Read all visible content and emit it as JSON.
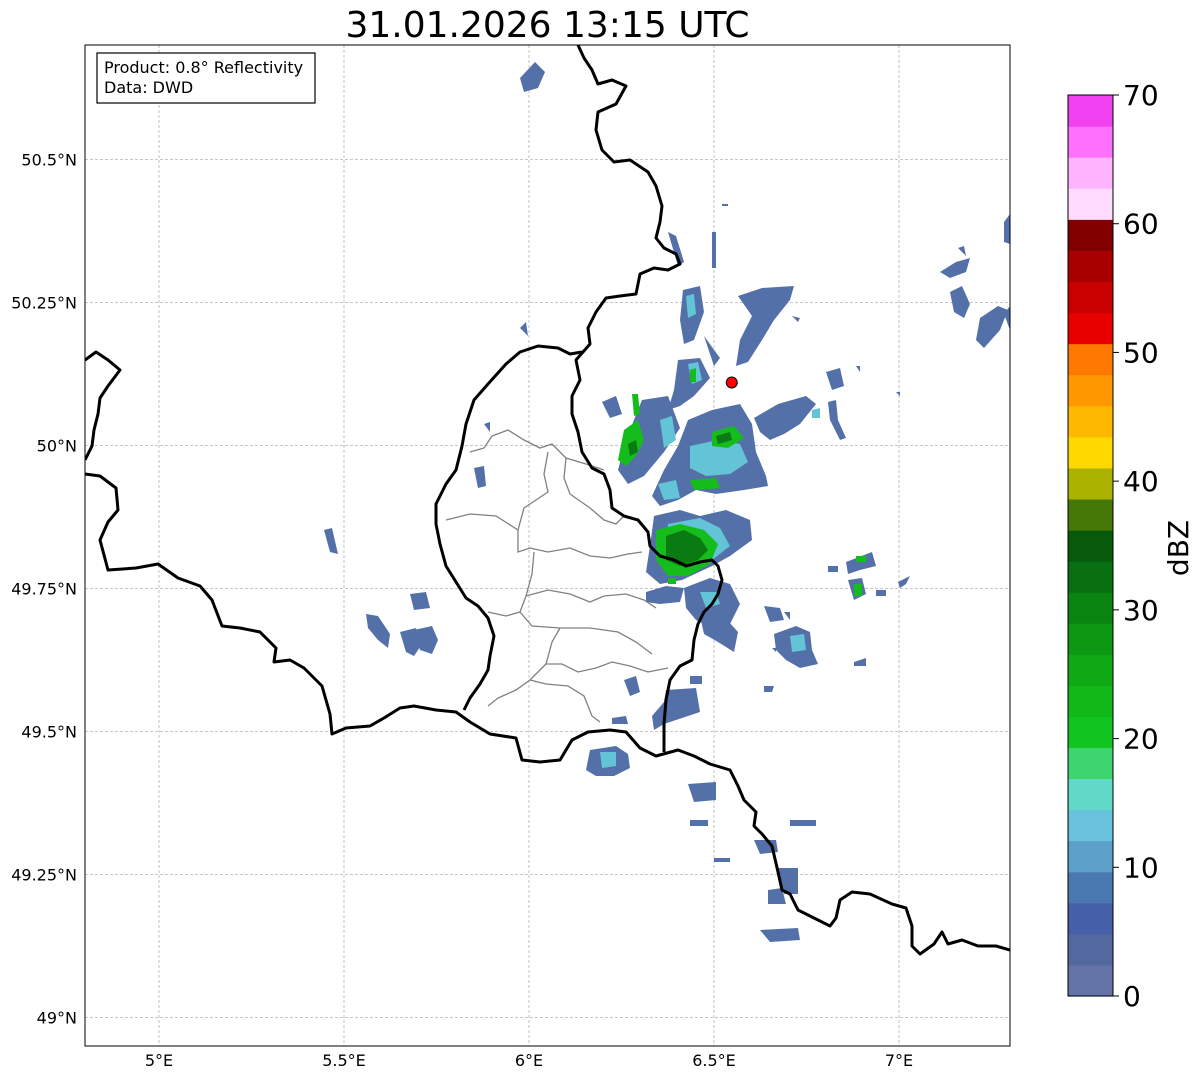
{
  "title": "31.01.2026 13:15 UTC",
  "info_box": {
    "product": "Product: 0.8° Reflectivity",
    "data": "Data: DWD"
  },
  "map": {
    "lon_range": [
      4.8,
      7.3
    ],
    "lat_range": [
      48.95,
      50.7
    ],
    "gridlines": true,
    "lon_ticks": [
      "5°E",
      "5.5°E",
      "6°E",
      "6.5°E",
      "7°E"
    ],
    "lat_ticks": [
      "49°N",
      "49.25°N",
      "49.5°N",
      "49.75°N",
      "50°N",
      "50.25°N",
      "50.5°N"
    ],
    "radar_site": {
      "lon": 6.548,
      "lat": 50.11,
      "color": "#ff0000"
    }
  },
  "colorbar": {
    "label": "dBZ",
    "min": 0,
    "max": 70,
    "tick_labels": [
      "0",
      "10",
      "20",
      "30",
      "40",
      "50",
      "60",
      "70"
    ],
    "colors": [
      "#6474a8",
      "#5468a0",
      "#4560a8",
      "#4a78b0",
      "#5aa0c8",
      "#68c2dc",
      "#62d8c8",
      "#3ed470",
      "#12c420",
      "#10b818",
      "#10a814",
      "#0c9812",
      "#0a8410",
      "#087010",
      "#065a0a",
      "#467808",
      "#aab400",
      "#ffd800",
      "#ffb800",
      "#ff9800",
      "#ff7800",
      "#e80000",
      "#c80000",
      "#a80000",
      "#800000",
      "#ffdcff",
      "#ffb4ff",
      "#ff70ff",
      "#f040f0"
    ]
  }
}
